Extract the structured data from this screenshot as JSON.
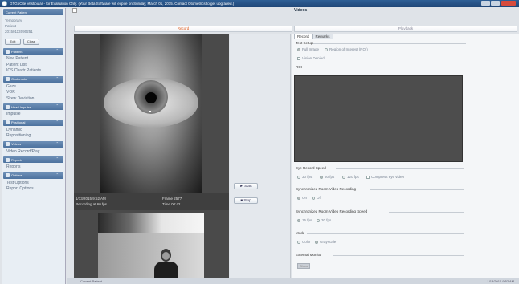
{
  "window": {
    "title": "GTGoCite Vestibular - for Evaluation Only. (Your Beta Software will expire on Sunday, March 01, 2015. Contact Otometrics to get upgraded.)"
  },
  "sidebar": {
    "current_patient_header": "Current Patient",
    "patient": {
      "line1": "Temporary",
      "line2": "Patient",
      "line3": "20150113090251"
    },
    "edit_button": "Edit",
    "close_button": "Close",
    "sections": [
      {
        "header": "Patients",
        "items": [
          "New Patient",
          "Patient List",
          "ICS Chartr Patients"
        ]
      },
      {
        "header": "Oculomotor",
        "items": [
          "Gaze",
          "VOR",
          "Skew Deviation"
        ]
      },
      {
        "header": "Head Impulse",
        "items": [
          "Impulse"
        ]
      },
      {
        "header": "Positional",
        "items": [
          "Dynamic",
          "Repositioning"
        ]
      },
      {
        "header": "Videos",
        "items": [
          "Video Record/Play"
        ]
      },
      {
        "header": "Reports",
        "items": [
          "Reports"
        ]
      },
      {
        "header": "Options",
        "items": [
          "Test Options",
          "Report Options"
        ]
      }
    ]
  },
  "main": {
    "videos_label": "Videos",
    "tabs": [
      {
        "label": "Record",
        "active": true
      },
      {
        "label": "Playback",
        "active": false
      }
    ]
  },
  "video": {
    "date_time": "1/13/2015 9:52 AM",
    "status": "Recording at 60 fps",
    "frame": "Frame 2577",
    "time": "Time 00:42"
  },
  "controls": {
    "start_label": "Start",
    "stop_label": "Stop"
  },
  "right_panel": {
    "tabs": [
      {
        "label": "Record",
        "active": true
      },
      {
        "label": "Remarks",
        "active": false
      }
    ],
    "test_setup": {
      "title": "Test Setup",
      "options": [
        {
          "label": "Full Image",
          "selected": true
        },
        {
          "label": "Region of Interest (ROI)",
          "selected": false
        }
      ],
      "vision_denied": "Vision Denied",
      "roi_label": "ROI"
    },
    "eye_record_speed": {
      "title": "Eye Record Speed",
      "options": [
        {
          "label": "30 fps",
          "selected": false
        },
        {
          "label": "60 fps",
          "selected": true
        },
        {
          "label": "120 fps",
          "selected": false
        }
      ],
      "compress": "Compress eye video"
    },
    "sync_room": {
      "title": "Synchronized Room Video Recording",
      "options": [
        {
          "label": "On",
          "selected": true
        },
        {
          "label": "Off",
          "selected": false
        }
      ]
    },
    "sync_room_speed": {
      "title": "Synchronized Room Video Recording Speed",
      "options": [
        {
          "label": "15 fps",
          "selected": true
        },
        {
          "label": "30 fps",
          "selected": false
        }
      ]
    },
    "mode": {
      "title": "Mode",
      "options": [
        {
          "label": "Color",
          "selected": false
        },
        {
          "label": "Grayscale",
          "selected": true
        }
      ]
    },
    "external_monitor": {
      "title": "External Monitor",
      "button": "Show"
    }
  },
  "statusbar": {
    "left": "Current Patient",
    "right": "1/13/2015 9:52 AM"
  }
}
